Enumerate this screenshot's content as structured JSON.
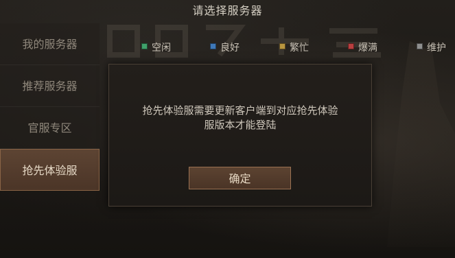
{
  "header": {
    "title": "请选择服务器"
  },
  "sidebar": {
    "items": [
      {
        "label": "我的服务器",
        "active": false
      },
      {
        "label": "推荐服务器",
        "active": false
      },
      {
        "label": "官服专区",
        "active": false
      },
      {
        "label": "抢先体验服",
        "active": true
      }
    ]
  },
  "legend": {
    "items": [
      {
        "label": "空闲",
        "color": "#3fa06a"
      },
      {
        "label": "良好",
        "color": "#3e78b8"
      },
      {
        "label": "繁忙",
        "color": "#b8953f"
      },
      {
        "label": "爆满",
        "color": "#b83f3f"
      },
      {
        "label": "维护",
        "color": "#8f8f8f"
      }
    ]
  },
  "dialog": {
    "message_line1": "抢先体验服需要更新客户端到对应抢先体验",
    "message_line2": "服版本才能登陆",
    "confirm_label": "确定"
  }
}
